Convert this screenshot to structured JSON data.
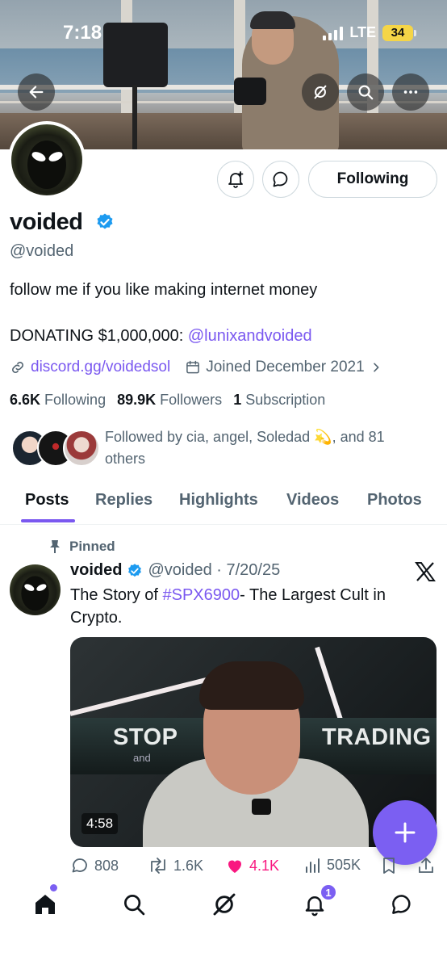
{
  "status_bar": {
    "time": "7:18",
    "network": "LTE",
    "battery": "34"
  },
  "profile": {
    "display_name": "voided",
    "handle": "@voided",
    "following_button": "Following",
    "bio": "follow me if you like making internet money",
    "donating_prefix": "DONATING $1,000,000: ",
    "donating_mention": "@lunixandvoided",
    "website": "discord.gg/voidedsol",
    "joined": "Joined December 2021",
    "following_count": "6.6K",
    "following_label": "Following",
    "followers_count": "89.9K",
    "followers_label": "Followers",
    "subscription_count": "1",
    "subscription_label": "Subscription",
    "followed_by": "Followed by cia, angel, Soledad 💫, and 81 others"
  },
  "tabs": [
    {
      "label": "Posts",
      "active": true
    },
    {
      "label": "Replies",
      "active": false
    },
    {
      "label": "Highlights",
      "active": false
    },
    {
      "label": "Videos",
      "active": false
    },
    {
      "label": "Photos",
      "active": false
    }
  ],
  "post": {
    "pinned_label": "Pinned",
    "author_name": "voided",
    "author_handle_date": "@voided · 7/20/25",
    "text_prefix": "The Story of ",
    "hashtag": "#SPX6900",
    "text_suffix": "- The Largest Cult in Crypto.",
    "video": {
      "overlay_left": "STOP",
      "overlay_small": "and",
      "overlay_right": "TRADING",
      "duration": "4:58"
    },
    "replies": "808",
    "reposts": "1.6K",
    "likes": "4.1K",
    "views": "505K"
  },
  "bottom_nav": {
    "notifications_badge": "1"
  },
  "colors": {
    "accent": "#7a58f0",
    "like": "#f91880",
    "verified": "#1d9bf0"
  }
}
